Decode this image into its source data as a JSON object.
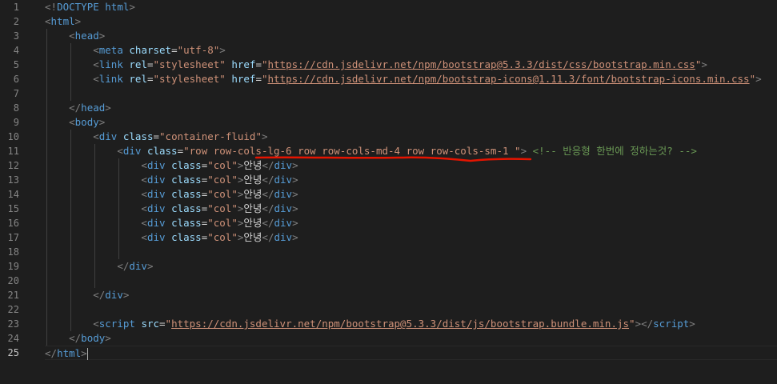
{
  "editor": {
    "line_numbers": [
      "1",
      "2",
      "3",
      "4",
      "5",
      "6",
      "7",
      "8",
      "9",
      "10",
      "11",
      "12",
      "13",
      "14",
      "15",
      "16",
      "17",
      "18",
      "19",
      "20",
      "21",
      "22",
      "23",
      "24",
      "25"
    ],
    "active_line": "25",
    "annotation_color": "#e51400"
  },
  "code": {
    "l1": {
      "doctype_open": "<!",
      "doctype_kw": "DOCTYPE",
      "doctype_name": " html",
      "close": ">"
    },
    "l2": {
      "tag": "html"
    },
    "l3": {
      "tag": "head"
    },
    "l4": {
      "tag": "meta",
      "attr": "charset",
      "value": "\"utf-8\""
    },
    "l5": {
      "tag": "link",
      "attr1": "rel",
      "value1": "\"stylesheet\"",
      "attr2": "href",
      "url": "https://cdn.jsdelivr.net/npm/bootstrap@5.3.3/dist/css/bootstrap.min.css"
    },
    "l7": {
      "tag": "link",
      "attr1": "rel",
      "value1": "\"stylesheet\"",
      "attr2": "href",
      "url": "https://cdn.jsdelivr.net/npm/bootstrap-icons@1.11.3/font/bootstrap-icons.min.css"
    },
    "l8": {
      "tag": "head"
    },
    "l9": {
      "tag": "body"
    },
    "l10": {
      "tag": "div",
      "attr": "class",
      "value": "\"container-fluid\""
    },
    "l11": {
      "tag": "div",
      "attr": "class",
      "value": "\"row row-cols-lg-6 row row-cols-md-4 row row-cols-sm-1 \"",
      "comment": "<!-- 반응형 한번에 정하는것? -->"
    },
    "col_rows": [
      {
        "tag": "div",
        "attr": "class",
        "value": "\"col\"",
        "text": "안녕"
      },
      {
        "tag": "div",
        "attr": "class",
        "value": "\"col\"",
        "text": "안녕"
      },
      {
        "tag": "div",
        "attr": "class",
        "value": "\"col\"",
        "text": "안녕"
      },
      {
        "tag": "div",
        "attr": "class",
        "value": "\"col\"",
        "text": "안녕"
      },
      {
        "tag": "div",
        "attr": "class",
        "value": "\"col\"",
        "text": "안녕"
      },
      {
        "tag": "div",
        "attr": "class",
        "value": "\"col\"",
        "text": "안녕"
      }
    ],
    "l19": {
      "tag": "div"
    },
    "l21": {
      "tag": "div"
    },
    "l23": {
      "tag": "script",
      "attr": "src",
      "url": "https://cdn.jsdelivr.net/npm/bootstrap@5.3.3/dist/js/bootstrap.bundle.min.js"
    },
    "l24": {
      "tag": "body"
    },
    "l25": {
      "tag": "html"
    }
  }
}
